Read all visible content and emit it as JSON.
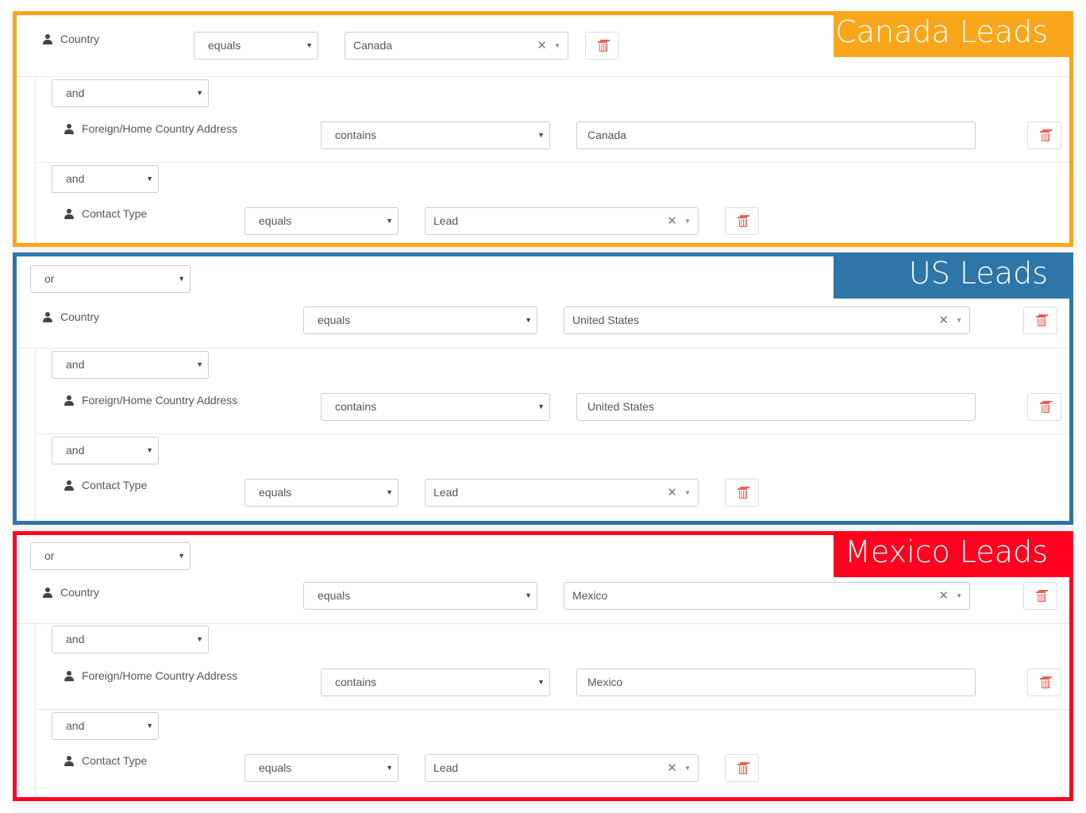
{
  "groups": [
    {
      "title": "Canada Leads",
      "color": "#faa61a",
      "connector": null,
      "conditions": [
        {
          "connector": null,
          "field": "Country",
          "operator": "equals",
          "value": "Canada",
          "value_type": "chosen"
        },
        {
          "connector": "and",
          "field": "Foreign/Home Country Address",
          "operator": "contains",
          "value": "Canada",
          "value_type": "text"
        },
        {
          "connector": "and",
          "field": "Contact Type",
          "operator": "equals",
          "value": "Lead",
          "value_type": "chosen"
        }
      ]
    },
    {
      "title": "US Leads",
      "color": "#2e76a8",
      "connector": "or",
      "conditions": [
        {
          "connector": null,
          "field": "Country",
          "operator": "equals",
          "value": "United States",
          "value_type": "chosen"
        },
        {
          "connector": "and",
          "field": "Foreign/Home Country Address",
          "operator": "contains",
          "value": "United States",
          "value_type": "text"
        },
        {
          "connector": "and",
          "field": "Contact Type",
          "operator": "equals",
          "value": "Lead",
          "value_type": "chosen"
        }
      ]
    },
    {
      "title": "Mexico Leads",
      "color": "#ff0020",
      "connector": "or",
      "conditions": [
        {
          "connector": null,
          "field": "Country",
          "operator": "equals",
          "value": "Mexico",
          "value_type": "chosen"
        },
        {
          "connector": "and",
          "field": "Foreign/Home Country Address",
          "operator": "contains",
          "value": "Mexico",
          "value_type": "text"
        },
        {
          "connector": "and",
          "field": "Contact Type",
          "operator": "equals",
          "value": "Lead",
          "value_type": "chosen"
        }
      ]
    }
  ],
  "icons": {
    "field": "user-icon",
    "delete": "trash-icon",
    "dropdown": "caret-down",
    "clear": "times"
  },
  "glyphs": {
    "caret": "▼",
    "clear": "✕"
  }
}
